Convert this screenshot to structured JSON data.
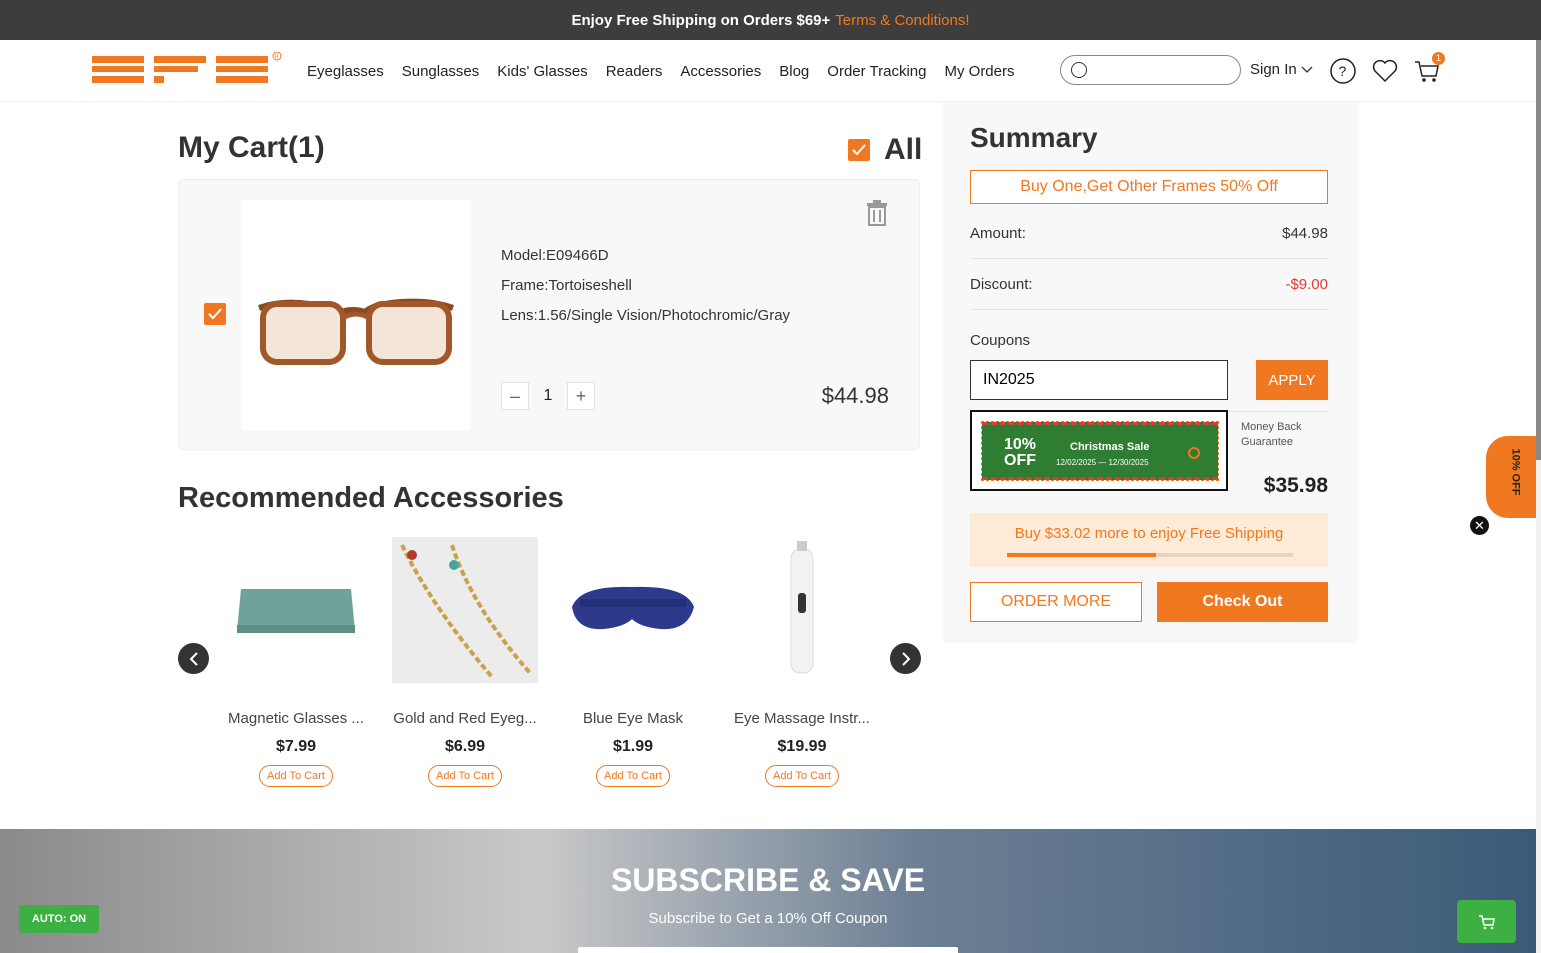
{
  "topbar": {
    "text": "Enjoy Free Shipping on Orders $69+",
    "link": "Terms & Conditions!"
  },
  "header": {
    "logo_text": "EFE",
    "nav": [
      "Eyeglasses",
      "Sunglasses",
      "Kids' Glasses",
      "Readers",
      "Accessories",
      "Blog",
      "Order Tracking",
      "My Orders"
    ],
    "search_placeholder": "",
    "signin": "Sign In",
    "cart_count": "1"
  },
  "cart": {
    "title": "My Cart(1)",
    "all_label": "All",
    "item": {
      "model": "Model:E09466D",
      "frame": "Frame:Tortoiseshell",
      "lens": "Lens:1.56/Single Vision/Photochromic/Gray",
      "quantity": "1",
      "price": "$44.98"
    }
  },
  "recommended": {
    "title": "Recommended Accessories",
    "products": [
      {
        "name": "Magnetic Glasses ...",
        "price": "$7.99",
        "button": "Add To Cart"
      },
      {
        "name": "Gold and Red Eyeg...",
        "price": "$6.99",
        "button": "Add To Cart"
      },
      {
        "name": "Blue Eye Mask",
        "price": "$1.99",
        "button": "Add To Cart"
      },
      {
        "name": "Eye Massage Instr...",
        "price": "$19.99",
        "button": "Add To Cart"
      }
    ]
  },
  "summary": {
    "title": "Summary",
    "promo": "Buy One,Get Other Frames 50% Off",
    "amount_label": "Amount:",
    "amount": "$44.98",
    "discount_label": "Discount:",
    "discount": "-$9.00",
    "coupons_label": "Coupons",
    "coupon_value": "IN2025",
    "apply": "APPLY",
    "money_back": "Money Back Guarantee",
    "total": "$35.98",
    "shipping_text": "Buy $33.02 more to enjoy Free Shipping",
    "shipping_progress": 0.52,
    "order_more": "ORDER MORE",
    "checkout": "Check Out"
  },
  "coupon_popup": {
    "off_line1": "10%",
    "off_line2": "OFF",
    "name": "Christmas Sale",
    "dates": "12/02/2025 — 12/30/2025"
  },
  "side_tab": "10% OFF",
  "subscribe": {
    "title": "SUBSCRIBE & SAVE",
    "subtitle": "Subscribe to Get a 10% Off Coupon"
  },
  "auto_badge": "AUTO: ON",
  "colors": {
    "accent": "#f07820",
    "dark_bar": "#3d3d3d",
    "discount": "#e53935",
    "green": "#3cb043"
  }
}
